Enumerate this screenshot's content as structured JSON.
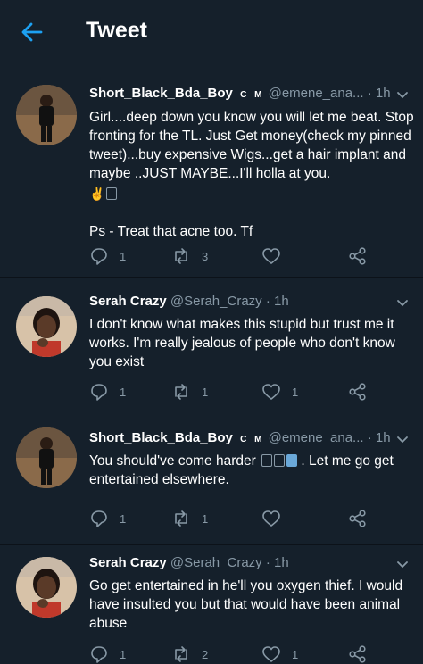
{
  "header": {
    "title": "Tweet"
  },
  "tweets": [
    {
      "name": "Short_Black_Bda_Boy",
      "badge": "C M",
      "handle": "@emene_ana...",
      "time": "· 1h",
      "text": "Girl....deep down you know you will let me beat. Stop fronting for the TL. Just Get money(check my pinned tweet)...buy expensive Wigs...get a hair implant and maybe ..JUST MAYBE...I'll holla at you.",
      "text2": "Ps - Treat that acne too. Tf",
      "replies": "1",
      "retweets": "3",
      "likes": ""
    },
    {
      "name": "Serah Crazy",
      "badge": "",
      "handle": "@Serah_Crazy",
      "time": "· 1h",
      "text": "I don't know what makes this stupid but trust me it works. I'm really jealous of people who don't know you exist",
      "replies": "1",
      "retweets": "1",
      "likes": "1"
    },
    {
      "name": "Short_Black_Bda_Boy",
      "badge": "C M",
      "handle": "@emene_ana...",
      "time": "· 1h",
      "text_a": "You should've come harder",
      "text_b": ". Let me go get entertained elsewhere.",
      "replies": "1",
      "retweets": "1",
      "likes": ""
    },
    {
      "name": "Serah Crazy",
      "badge": "",
      "handle": "@Serah_Crazy",
      "time": "· 1h",
      "text": "Go get entertained in he'll you oxygen thief. I would have insulted you but that would have been animal abuse",
      "replies": "1",
      "retweets": "2",
      "likes": "1"
    }
  ],
  "colors": {
    "background": "#15202b",
    "accent": "#1da1f2",
    "muted": "#8899a6"
  }
}
